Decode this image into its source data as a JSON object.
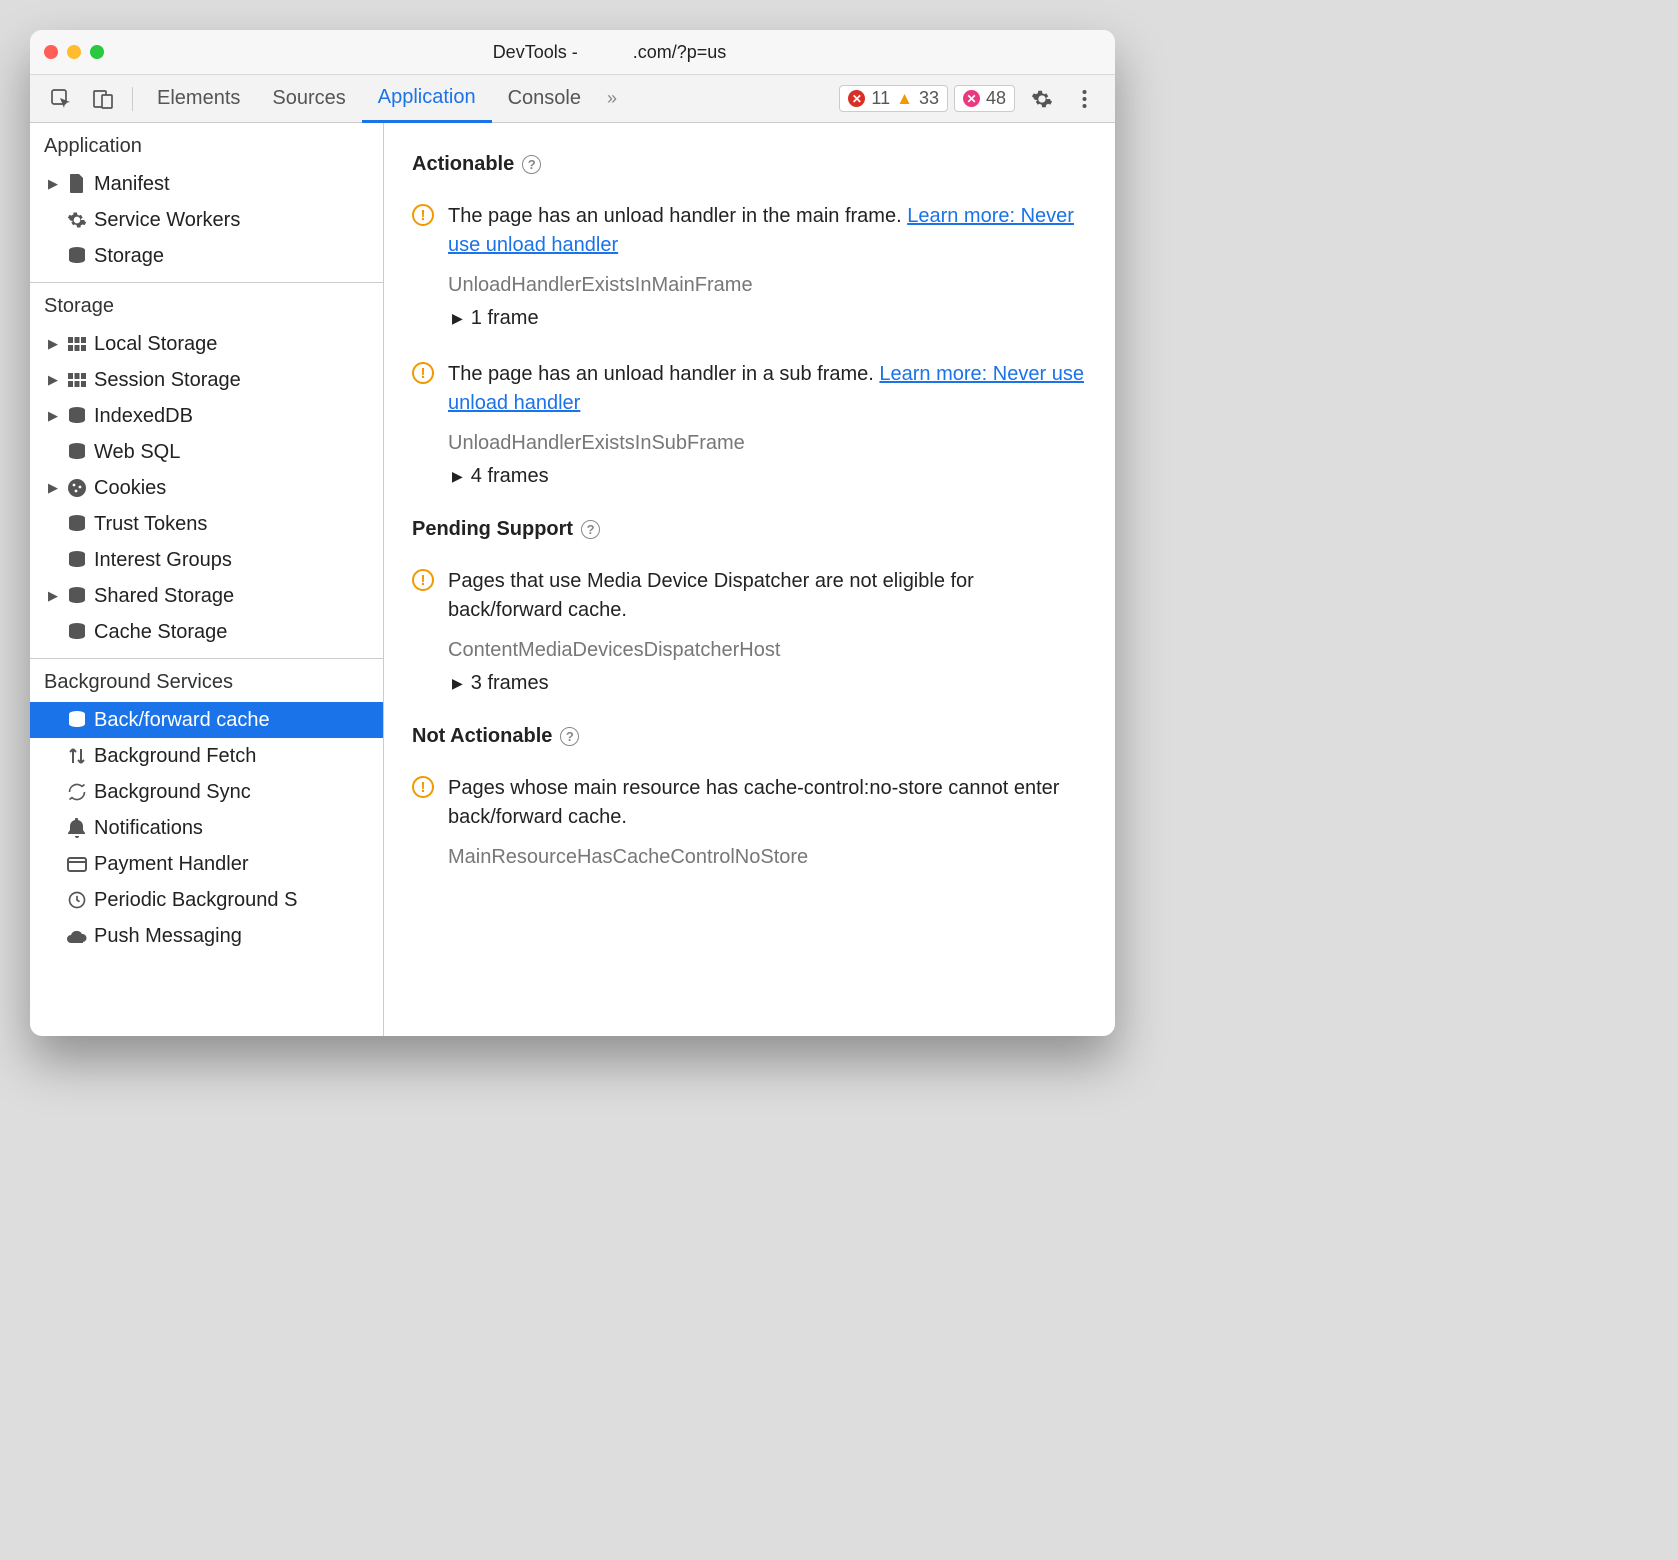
{
  "titlebar": {
    "prefix": "DevTools -",
    "suffix": ".com/?p=us"
  },
  "toolbar": {
    "tabs": [
      "Elements",
      "Sources",
      "Application",
      "Console"
    ],
    "active_index": 2,
    "errors": "11",
    "warnings": "33",
    "issues": "48"
  },
  "sidebar": {
    "sections": [
      {
        "title": "Application",
        "items": [
          {
            "label": "Manifest",
            "icon": "file",
            "caret": true
          },
          {
            "label": "Service Workers",
            "icon": "gear"
          },
          {
            "label": "Storage",
            "icon": "db"
          }
        ]
      },
      {
        "title": "Storage",
        "items": [
          {
            "label": "Local Storage",
            "icon": "grid",
            "caret": true
          },
          {
            "label": "Session Storage",
            "icon": "grid",
            "caret": true
          },
          {
            "label": "IndexedDB",
            "icon": "db",
            "caret": true
          },
          {
            "label": "Web SQL",
            "icon": "db"
          },
          {
            "label": "Cookies",
            "icon": "cookie",
            "caret": true
          },
          {
            "label": "Trust Tokens",
            "icon": "db"
          },
          {
            "label": "Interest Groups",
            "icon": "db"
          },
          {
            "label": "Shared Storage",
            "icon": "db",
            "caret": true
          },
          {
            "label": "Cache Storage",
            "icon": "db"
          }
        ]
      },
      {
        "title": "Background Services",
        "items": [
          {
            "label": "Back/forward cache",
            "icon": "db",
            "selected": true
          },
          {
            "label": "Background Fetch",
            "icon": "updown"
          },
          {
            "label": "Background Sync",
            "icon": "sync"
          },
          {
            "label": "Notifications",
            "icon": "bell"
          },
          {
            "label": "Payment Handler",
            "icon": "card"
          },
          {
            "label": "Periodic Background S",
            "icon": "clock"
          },
          {
            "label": "Push Messaging",
            "icon": "cloud"
          }
        ]
      }
    ]
  },
  "main": {
    "groups": [
      {
        "heading": "Actionable",
        "issues": [
          {
            "text": "The page has an unload handler in the main frame. ",
            "link": "Learn more: Never use unload handler",
            "code": "UnloadHandlerExistsInMainFrame",
            "frames": "1 frame"
          },
          {
            "text": "The page has an unload handler in a sub frame. ",
            "link": "Learn more: Never use unload handler",
            "code": "UnloadHandlerExistsInSubFrame",
            "frames": "4 frames"
          }
        ]
      },
      {
        "heading": "Pending Support",
        "issues": [
          {
            "text": "Pages that use Media Device Dispatcher are not eligible for back/forward cache.",
            "code": "ContentMediaDevicesDispatcherHost",
            "frames": "3 frames"
          }
        ]
      },
      {
        "heading": "Not Actionable",
        "issues": [
          {
            "text": "Pages whose main resource has cache-control:no-store cannot enter back/forward cache.",
            "code": "MainResourceHasCacheControlNoStore"
          }
        ]
      }
    ]
  }
}
